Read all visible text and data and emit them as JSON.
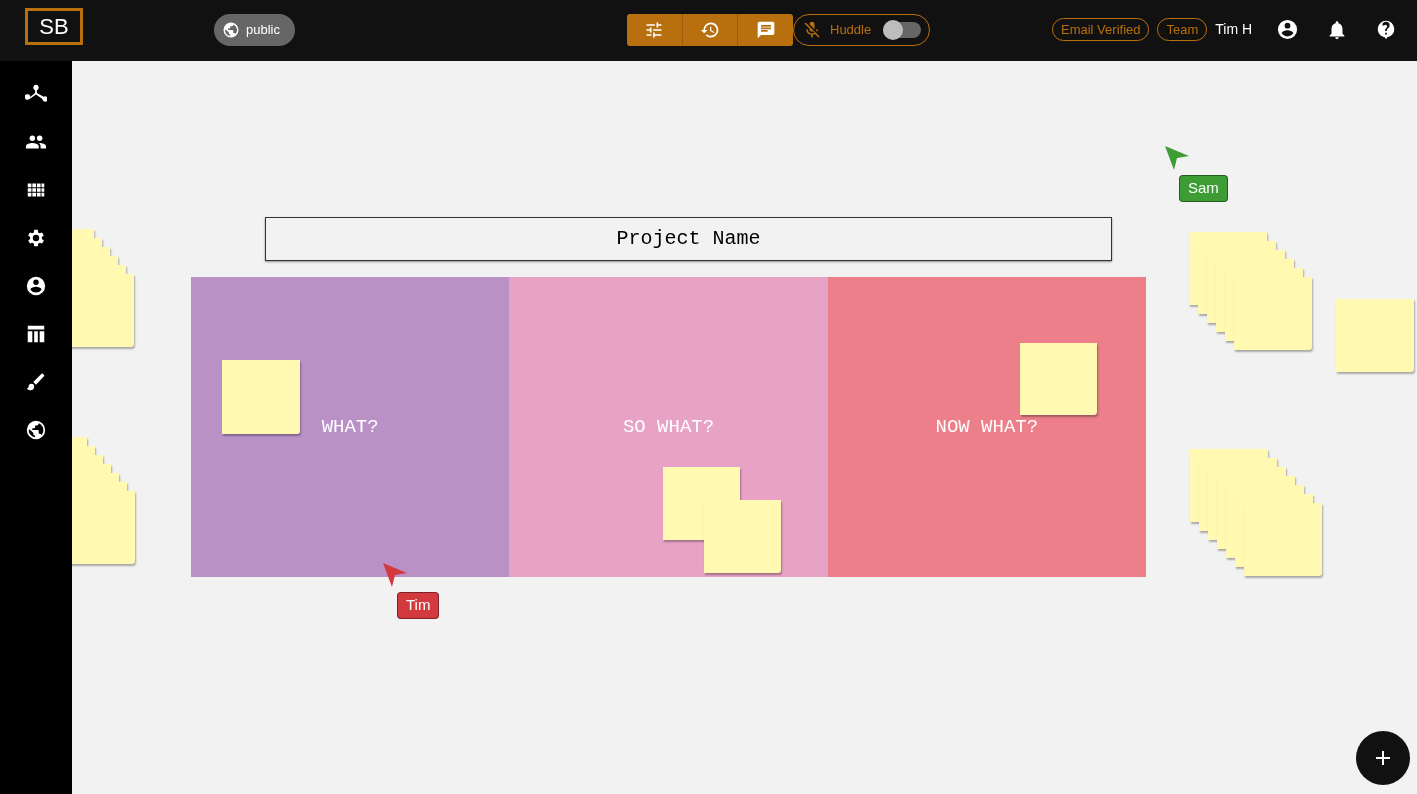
{
  "header": {
    "logo": "SB",
    "visibility": "public",
    "huddle": {
      "label": "Huddle",
      "on": false
    },
    "badges": [
      "Email Verified",
      "Team"
    ],
    "user_name": "Tim H"
  },
  "board": {
    "title": "Project Name",
    "columns": [
      {
        "label": "WHAT?",
        "color": "#b991c7"
      },
      {
        "label": "SO WHAT?",
        "color": "#e8a2c6"
      },
      {
        "label": "NOW WHAT?",
        "color": "#ec7f8a"
      }
    ]
  },
  "cursors": [
    {
      "name": "Sam",
      "color": "#3e9c35"
    },
    {
      "name": "Tim",
      "color": "#d23a3f"
    }
  ]
}
